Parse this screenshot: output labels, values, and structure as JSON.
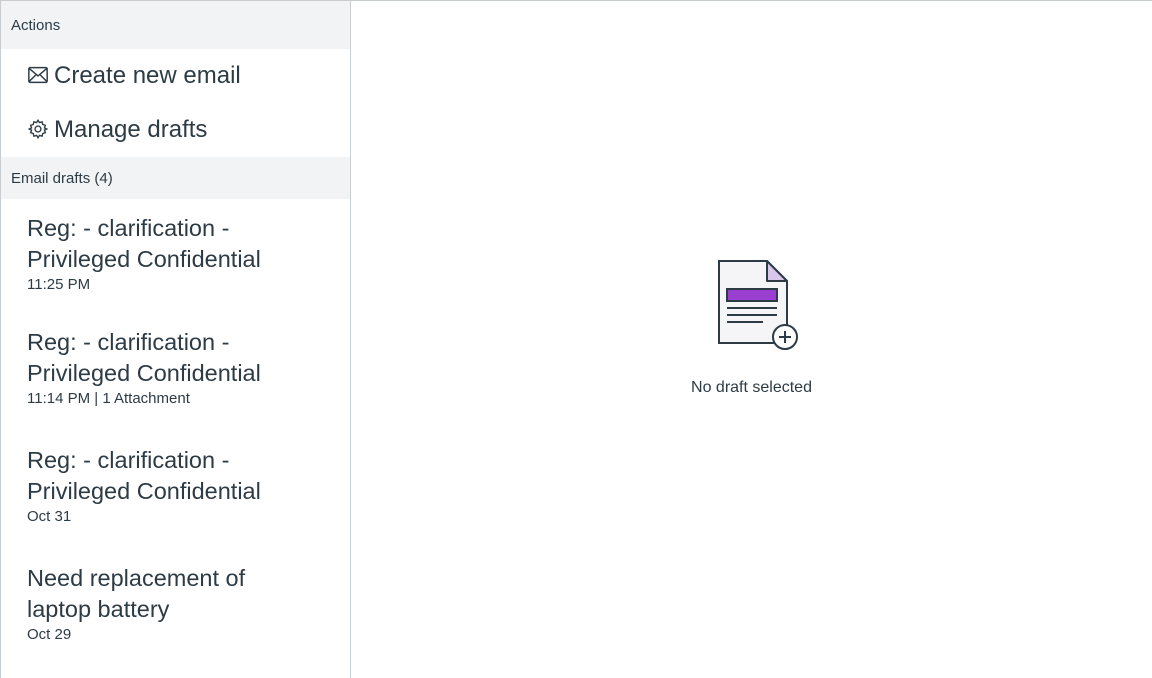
{
  "sidebar": {
    "actions_header": "Actions",
    "actions": [
      {
        "label": "Create new email",
        "icon": "envelope-icon"
      },
      {
        "label": "Manage drafts",
        "icon": "gear-icon"
      }
    ],
    "drafts_header": "Email drafts (4)",
    "drafts": [
      {
        "subject": "Reg: - clarification -\nPrivileged Confidential",
        "meta": "11:25 PM"
      },
      {
        "subject": "Reg: - clarification -\nPrivileged Confidential",
        "meta": "11:14 PM | 1 Attachment"
      },
      {
        "subject": "Reg: - clarification -\nPrivileged Confidential",
        "meta": "Oct 31"
      },
      {
        "subject": "Need replacement of\nlaptop battery",
        "meta": "Oct 29"
      }
    ]
  },
  "main": {
    "empty_icon": "document-add-icon",
    "empty_text": "No draft selected"
  },
  "colors": {
    "accent": "#9b3fd1",
    "header_bg": "#f2f3f5",
    "text": "#2d3b45",
    "border": "#c7cdd1"
  }
}
